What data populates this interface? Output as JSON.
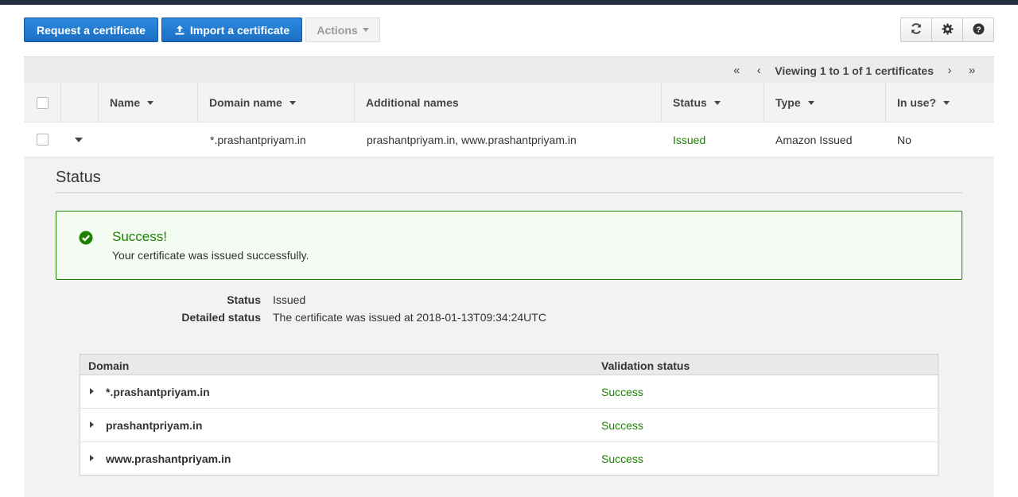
{
  "toolbar": {
    "request_label": "Request a certificate",
    "import_label": "Import a certificate",
    "actions_label": "Actions"
  },
  "pagination": {
    "text": "Viewing 1 to 1 of 1 certificates",
    "first": "«",
    "prev": "‹",
    "next": "›",
    "last": "»"
  },
  "table": {
    "columns": [
      "Name",
      "Domain name",
      "Additional names",
      "Status",
      "Type",
      "In use?"
    ],
    "rows": [
      {
        "name": "",
        "domain": "*.prashantpriyam.in",
        "additional": "prashantpriyam.in, www.prashantpriyam.in",
        "status": "Issued",
        "type": "Amazon Issued",
        "in_use": "No"
      }
    ]
  },
  "detail": {
    "heading": "Status",
    "alert": {
      "title": "Success!",
      "message": "Your certificate was issued successfully."
    },
    "fields": [
      {
        "label": "Status",
        "value": "Issued"
      },
      {
        "label": "Detailed status",
        "value": "The certificate was issued at 2018-01-13T09:34:24UTC"
      }
    ],
    "validation": {
      "headers": [
        "Domain",
        "Validation status"
      ],
      "rows": [
        {
          "domain": "*.prashantpriyam.in",
          "status": "Success"
        },
        {
          "domain": "prashantpriyam.in",
          "status": "Success"
        },
        {
          "domain": "www.prashantpriyam.in",
          "status": "Success"
        }
      ]
    }
  },
  "colors": {
    "primary": "#1a6fc4",
    "success": "#1d8102",
    "topbar": "#232f3e"
  }
}
